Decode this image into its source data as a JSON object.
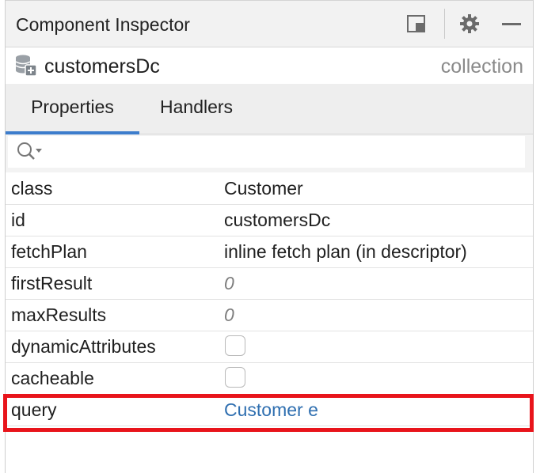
{
  "window": {
    "title": "Component Inspector"
  },
  "toolbar": {
    "icons": [
      "restore-layout-icon",
      "gear-icon",
      "minimize-icon"
    ]
  },
  "component": {
    "name": "customersDc",
    "type": "collection",
    "icon": "database-add-icon"
  },
  "tabs": [
    {
      "label": "Properties",
      "active": true
    },
    {
      "label": "Handlers",
      "active": false
    }
  ],
  "search": {
    "placeholder": "",
    "value": ""
  },
  "properties": [
    {
      "name": "class",
      "value": "Customer",
      "kind": "text"
    },
    {
      "name": "id",
      "value": "customersDc",
      "kind": "text"
    },
    {
      "name": "fetchPlan",
      "value": "inline fetch plan (in descriptor)",
      "kind": "text"
    },
    {
      "name": "firstResult",
      "value": "0",
      "kind": "default"
    },
    {
      "name": "maxResults",
      "value": "0",
      "kind": "default"
    },
    {
      "name": "dynamicAttributes",
      "checked": false,
      "kind": "checkbox"
    },
    {
      "name": "cacheable",
      "checked": false,
      "kind": "checkbox"
    },
    {
      "name": "query",
      "value": "Customer e",
      "kind": "link"
    }
  ],
  "colors": {
    "accent": "#3d7dcc",
    "link": "#2f6fb0",
    "highlight": "#e8141b"
  }
}
